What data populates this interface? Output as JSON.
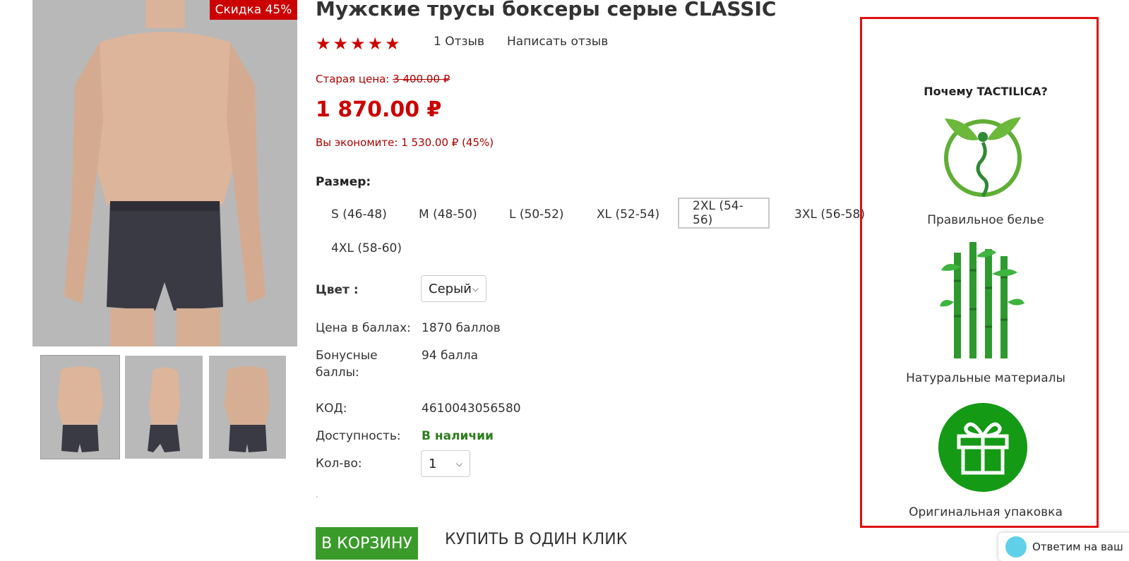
{
  "product": {
    "badge": "Скидка 45%",
    "title": "Мужские трусы боксеры серые CLASSIC",
    "stars": "★★★★★",
    "rating": 5,
    "reviews_link": "1 Отзыв",
    "write_review": "Написать отзыв",
    "old_price_label": "Старая цена:",
    "old_price": "3 400.00 ₽",
    "price": "1 870.00 ₽",
    "savings": "Вы экономите: 1 530.00 ₽ (45%)",
    "size_label": "Размер:",
    "sizes": [
      "S (46-48)",
      "M (48-50)",
      "L (50-52)",
      "XL (52-54)",
      "2XL (54-56)",
      "3XL (56-58)",
      "4XL (58-60)"
    ],
    "selected_size": "2XL (54-56)",
    "color_label": "Цвет :",
    "color_value": "Серый",
    "points_price_label": "Цена в баллах:",
    "points_price_value": "1870 баллов",
    "bonus_label_1": "Бонусные",
    "bonus_label_2": "баллы:",
    "bonus_value": "94 балла",
    "code_label": "КОД:",
    "code_value": "4610043056580",
    "availability_label": "Доступность:",
    "availability_value": "В наличии",
    "qty_label": "Кол-во:",
    "qty_value": "1",
    "dot": ".",
    "cart_button": "В КОРЗИНУ",
    "oneclick_button": "КУПИТЬ В ОДИН КЛИК"
  },
  "why": {
    "title": "Почему TACTILICA?",
    "items": [
      {
        "caption": "Правильное белье",
        "icon": "leaf-figure-icon"
      },
      {
        "caption": "Натуральные материалы",
        "icon": "bamboo-icon"
      },
      {
        "caption": "Оригинальная упаковка",
        "icon": "gift-icon"
      }
    ]
  },
  "chat": {
    "text": "Ответим на ваш"
  },
  "colors": {
    "accent_red": "#cc0000",
    "cart_green": "#3a9b2a",
    "panel_border": "#e01010",
    "available_green": "#2e7d1e"
  }
}
